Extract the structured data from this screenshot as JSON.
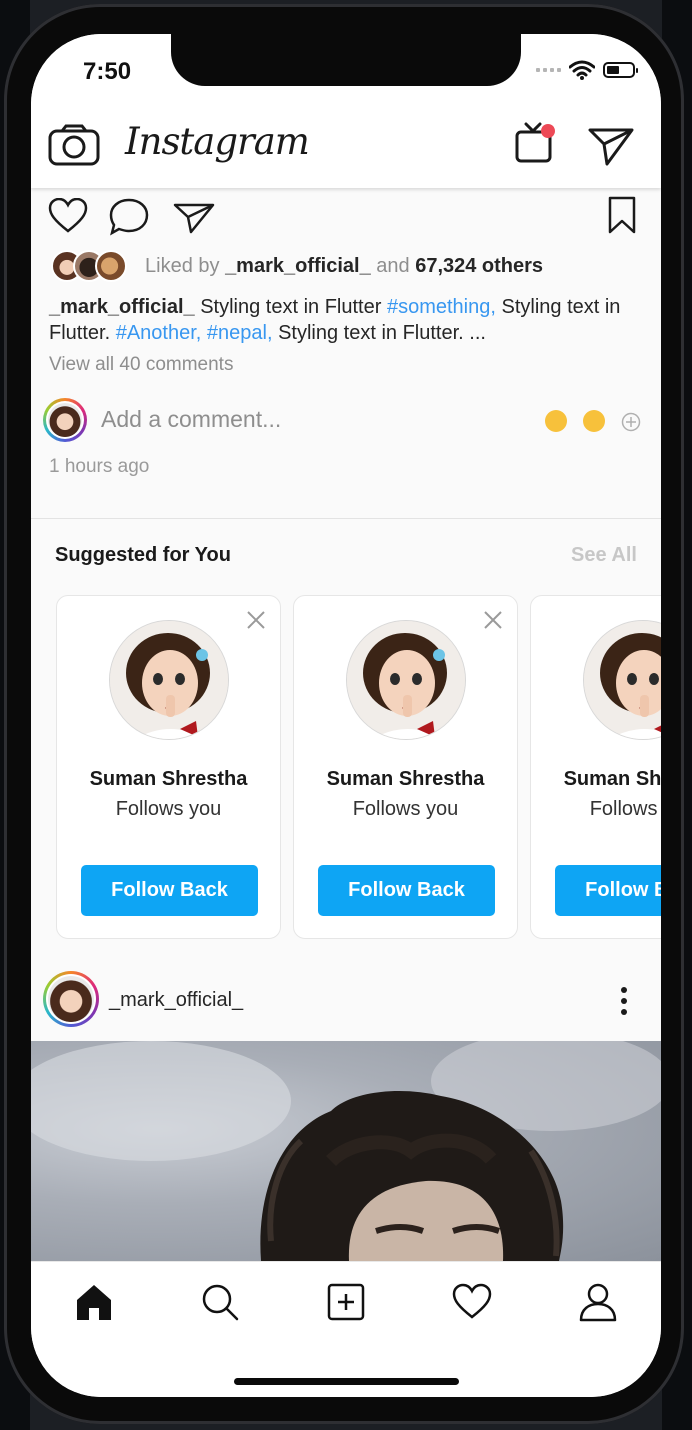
{
  "status": {
    "time": "7:50"
  },
  "header": {
    "logo": "Instagram",
    "tv_badge_color": "#ed4956"
  },
  "post_actions": {
    "liked_by_prefix": "Liked by",
    "liked_by_user": "_mark_official_",
    "liked_by_and": "and",
    "liked_by_count": "67,324 others",
    "caption_user": "_mark_official_",
    "caption_seg1": "Styling text in Flutter",
    "caption_tag1": "#something,",
    "caption_seg2": "Styling text in Flutter.",
    "caption_tag2": "#Another,",
    "caption_tag3": "#nepal,",
    "caption_seg3": "Styling text in Flutter. ...",
    "view_comments": "View all 40 comments",
    "comment_placeholder": "Add a comment...",
    "time_ago": "1 hours ago"
  },
  "suggestions": {
    "title": "Suggested for You",
    "see_all": "See All",
    "cards": [
      {
        "name": "Suman Shrestha",
        "subtitle": "Follows you",
        "button": "Follow Back"
      },
      {
        "name": "Suman Shrestha",
        "subtitle": "Follows you",
        "button": "Follow Back"
      },
      {
        "name": "Suman Shrestha",
        "subtitle": "Follows you",
        "button": "Follow Back"
      }
    ]
  },
  "next_post": {
    "username": "_mark_official_"
  },
  "tabbar": {
    "items": [
      "home-icon",
      "search-icon",
      "add-post-icon",
      "activity-heart-icon",
      "profile-icon"
    ]
  },
  "colors": {
    "accent": "#0ea5f4",
    "hashtag": "#3897f0"
  }
}
